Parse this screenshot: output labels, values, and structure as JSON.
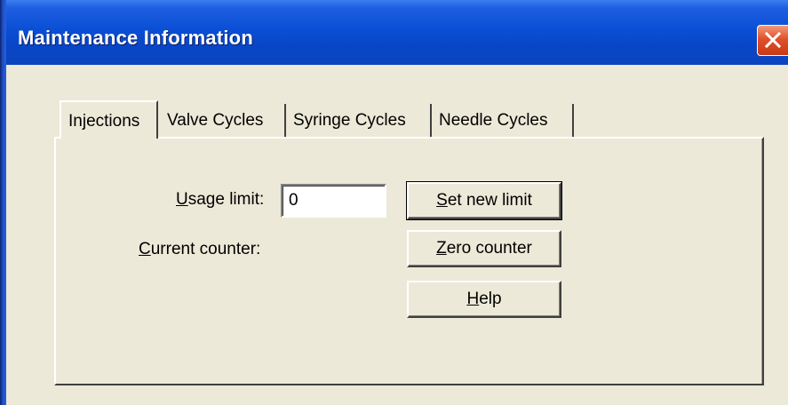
{
  "window": {
    "title": "Maintenance Information",
    "close_symbol": "✕"
  },
  "tabs": [
    {
      "label": "Injections",
      "active": true
    },
    {
      "label": "Valve Cycles",
      "active": false
    },
    {
      "label": "Syringe Cycles",
      "active": false
    },
    {
      "label": "Needle Cycles",
      "active": false
    }
  ],
  "form": {
    "usage_limit_label_ul": "U",
    "usage_limit_label_rest": "sage limit:",
    "usage_limit_value": "0",
    "current_counter_label_ul": "C",
    "current_counter_label_rest": "urrent counter:"
  },
  "buttons": {
    "set_limit_ul": "S",
    "set_limit_rest": "et new limit",
    "zero_counter_ul": "Z",
    "zero_counter_rest": "ero counter",
    "help_ul": "H",
    "help_rest": "elp"
  },
  "colors": {
    "titlebar": "#0A4FD6",
    "dialog_bg": "#ECE9D8",
    "close_button": "#E0512B"
  },
  "icons": {
    "close": "close-icon"
  }
}
